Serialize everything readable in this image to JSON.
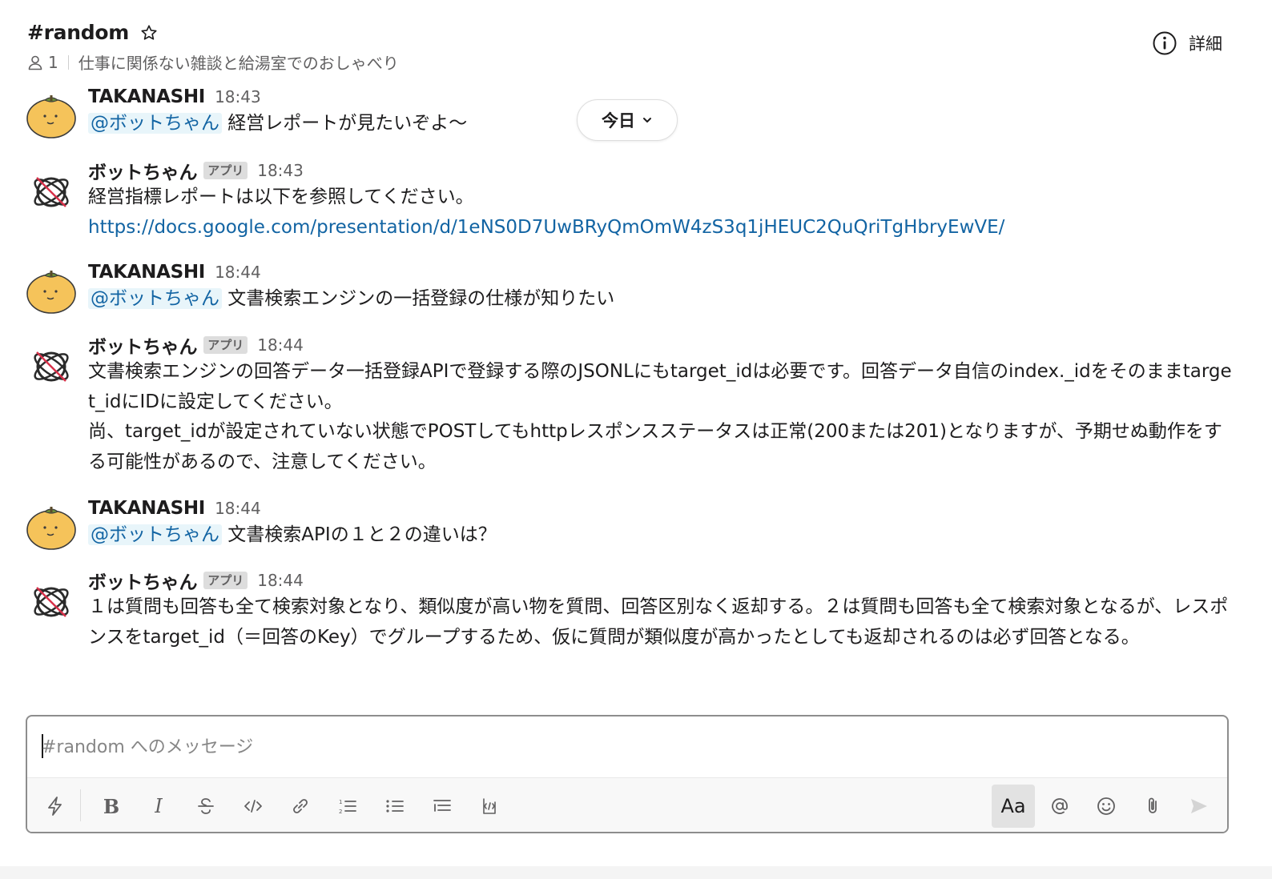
{
  "header": {
    "channel_name": "#random",
    "member_count": "1",
    "topic": "仕事に関係ない雑談と給湯室でのおしゃべり",
    "details_label": "詳細",
    "icons": [
      "star-icon",
      "member-icon",
      "info-icon"
    ]
  },
  "today_pill": {
    "label": "今日",
    "icon": "chevron-down-icon"
  },
  "messages": [
    {
      "sender": "TAKANASHI",
      "time": "18:43",
      "mention": "@ボットちゃん",
      "text": " 経営レポートが見たいぞよ〜"
    },
    {
      "sender": "ボットちゃん",
      "badge": "アプリ",
      "time": "18:43",
      "text": "経営指標レポートは以下を参照してください。",
      "link": "https://docs.google.com/presentation/d/1eNS0D7UwBRyQmOmW4zS3q1jHEUC2QuQriTgHbryEwVE/"
    },
    {
      "sender": "TAKANASHI",
      "time": "18:44",
      "mention": "@ボットちゃん",
      "text": " 文書検索エンジンの一括登録の仕様が知りたい"
    },
    {
      "sender": "ボットちゃん",
      "badge": "アプリ",
      "time": "18:44",
      "text": "文書検索エンジンの回答データ一括登録APIで登録する際のJSONLにもtarget_idは必要です。回答データ自信のindex._idをそのままtarget_idにIDに設定してください。\n尚、target_idが設定されていない状態でPOSTしてもhttpレスポンスステータスは正常(200または201)となりますが、予期せぬ動作をする可能性があるので、注意してください。"
    },
    {
      "sender": "TAKANASHI",
      "time": "18:44",
      "mention": "@ボットちゃん",
      "text": " 文書検索APIの１と２の違いは？"
    },
    {
      "sender": "ボットちゃん",
      "badge": "アプリ",
      "time": "18:44",
      "text": "１は質問も回答も全て検索対象となり、類似度が高い物を質問、回答区別なく返却する。２は質問も回答も全て検索対象となるが、レスポンスをtarget_id（＝回答のKey）でグループするため、仮に質問が類似度が高かったとしても返却されるのは必ず回答となる。"
    }
  ],
  "composer": {
    "placeholder": "#random へのメッセージ",
    "format_label": "Aa",
    "tools": [
      "shortcuts-icon",
      "bold-icon",
      "italic-icon",
      "strikethrough-icon",
      "code-icon",
      "link-icon",
      "ordered-list-icon",
      "bulleted-list-icon",
      "blockquote-icon",
      "code-block-icon",
      "format-toggle",
      "mention-icon",
      "emoji-icon",
      "attachment-icon",
      "send-icon"
    ]
  }
}
